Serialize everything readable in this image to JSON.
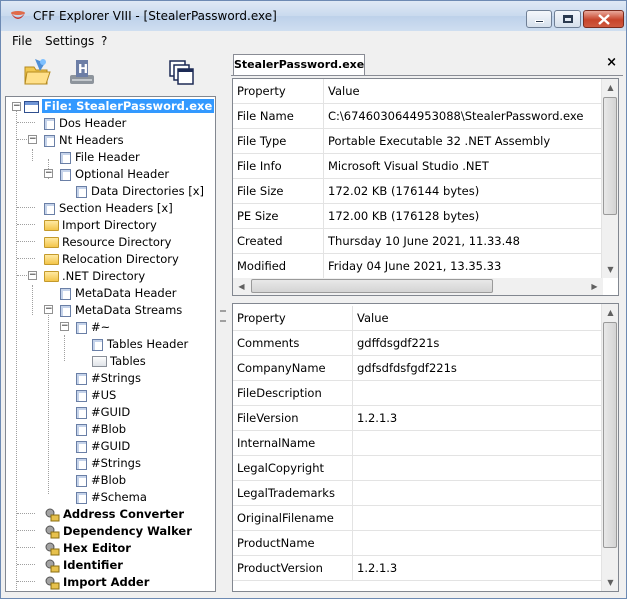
{
  "window": {
    "title": "CFF Explorer VIII - [StealerPassword.exe]"
  },
  "menu": [
    "File",
    "Settings",
    "?"
  ],
  "toolbar": {
    "buttons": [
      "open-icon",
      "hex-editor-icon",
      "windows-icon"
    ]
  },
  "tree": {
    "nodes": [
      {
        "label": "File: StealerPassword.exe",
        "icon": "file-icon"
      },
      {
        "label": "Dos Header",
        "icon": "item-icon"
      },
      {
        "label": "Nt Headers",
        "icon": "item-icon"
      },
      {
        "label": "File Header",
        "icon": "item-icon"
      },
      {
        "label": "Optional Header",
        "icon": "item-icon"
      },
      {
        "label": "Data Directories [x]",
        "icon": "item-icon"
      },
      {
        "label": "Section Headers [x]",
        "icon": "item-icon"
      },
      {
        "label": "Import Directory",
        "icon": "folder-icon"
      },
      {
        "label": "Resource Directory",
        "icon": "folder-icon"
      },
      {
        "label": "Relocation Directory",
        "icon": "folder-icon"
      },
      {
        "label": ".NET Directory",
        "icon": "folder-icon"
      },
      {
        "label": "MetaData Header",
        "icon": "item-icon"
      },
      {
        "label": "MetaData Streams",
        "icon": "item-icon"
      },
      {
        "label": "#~",
        "icon": "item-icon"
      },
      {
        "label": "Tables Header",
        "icon": "item-icon"
      },
      {
        "label": "Tables",
        "icon": "folder-open-icon"
      },
      {
        "label": "#Strings",
        "icon": "item-icon"
      },
      {
        "label": "#US",
        "icon": "item-icon"
      },
      {
        "label": "#GUID",
        "icon": "item-icon"
      },
      {
        "label": "#Blob",
        "icon": "item-icon"
      },
      {
        "label": "#GUID",
        "icon": "item-icon"
      },
      {
        "label": "#Strings",
        "icon": "item-icon"
      },
      {
        "label": "#Blob",
        "icon": "item-icon"
      },
      {
        "label": "#Schema",
        "icon": "item-icon"
      },
      {
        "label": "Address Converter",
        "icon": "tool-icon"
      },
      {
        "label": "Dependency Walker",
        "icon": "tool-icon"
      },
      {
        "label": "Hex Editor",
        "icon": "tool-icon"
      },
      {
        "label": "Identifier",
        "icon": "tool-icon"
      },
      {
        "label": "Import Adder",
        "icon": "tool-icon"
      }
    ]
  },
  "tab": {
    "label": "StealerPassword.exe",
    "close": "×"
  },
  "top_grid": {
    "headers": [
      "Property",
      "Value"
    ],
    "rows": [
      [
        "File Name",
        "C:\\6746030644953088\\StealerPassword.exe"
      ],
      [
        "File Type",
        "Portable Executable 32 .NET Assembly"
      ],
      [
        "File Info",
        "Microsoft Visual Studio .NET"
      ],
      [
        "File Size",
        "172.02 KB (176144 bytes)"
      ],
      [
        "PE Size",
        "172.00 KB (176128 bytes)"
      ],
      [
        "Created",
        "Thursday 10 June 2021, 11.33.48"
      ],
      [
        "Modified",
        "Friday 04 June 2021, 13.35.33"
      ]
    ]
  },
  "bottom_grid": {
    "headers": [
      "Property",
      "Value"
    ],
    "rows": [
      [
        "Comments",
        "gdffdsgdf221s"
      ],
      [
        "CompanyName",
        "gdfsdfdsfgdf221s"
      ],
      [
        "FileDescription",
        ""
      ],
      [
        "FileVersion",
        "1.2.1.3"
      ],
      [
        "InternalName",
        ""
      ],
      [
        "LegalCopyright",
        ""
      ],
      [
        "LegalTrademarks",
        ""
      ],
      [
        "OriginalFilename",
        ""
      ],
      [
        "ProductName",
        ""
      ],
      [
        "ProductVersion",
        "1.2.1.3"
      ]
    ]
  }
}
